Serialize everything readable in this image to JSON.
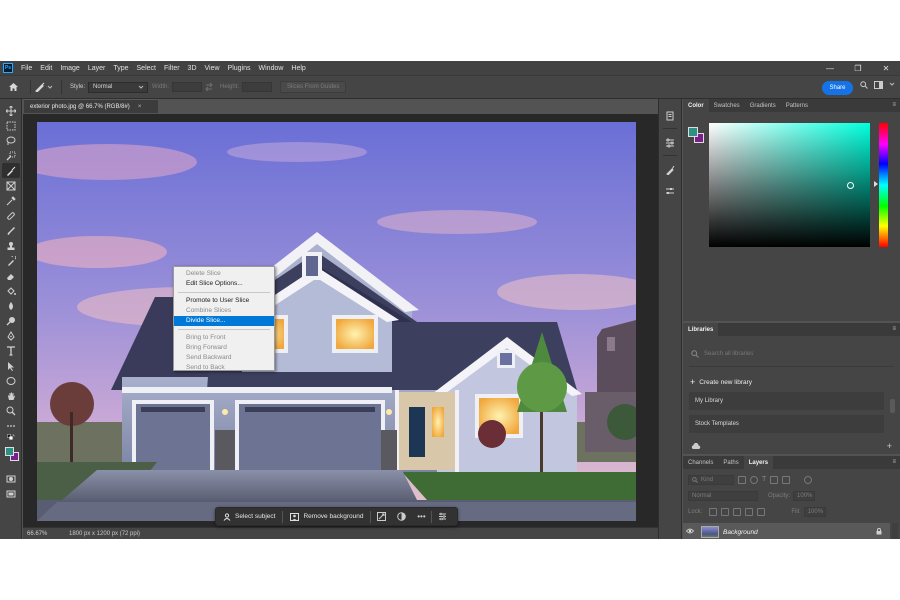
{
  "app": {
    "logo": "Ps",
    "brand_color": "#31a8ff",
    "accent": "#1473e6"
  },
  "menubar": {
    "items": [
      "File",
      "Edit",
      "Image",
      "Layer",
      "Type",
      "Select",
      "Filter",
      "3D",
      "View",
      "Plugins",
      "Window",
      "Help"
    ],
    "controls": {
      "minimize": "—",
      "restore": "❐",
      "close": "✕"
    }
  },
  "options": {
    "style_label": "Style:",
    "style_value": "Normal",
    "width_label": "Width:",
    "height_label": "Height:",
    "slices_button": "Slices From Guides",
    "share_label": "Share"
  },
  "document": {
    "tab_title": "exterior photo.jpg @ 66.7% (RGB/8#)",
    "tab_close": "×",
    "zoom": "66.67%",
    "info": "1800 px x 1200 px (72 ppi)"
  },
  "context_menu": {
    "items": [
      {
        "label": "Delete Slice",
        "state": "disabled"
      },
      {
        "label": "Edit Slice Options...",
        "state": "enabled"
      },
      {
        "label": "Promote to User Slice",
        "state": "enabled"
      },
      {
        "label": "Combine Slices",
        "state": "disabled"
      },
      {
        "label": "Divide Slice...",
        "state": "highlighted"
      },
      {
        "label": "Bring to Front",
        "state": "disabled"
      },
      {
        "label": "Bring Forward",
        "state": "disabled"
      },
      {
        "label": "Send Backward",
        "state": "disabled"
      },
      {
        "label": "Send to Back",
        "state": "disabled"
      }
    ]
  },
  "taskbar": {
    "select_subject": "Select subject",
    "remove_background": "Remove background",
    "more": "•••"
  },
  "color_panel": {
    "tabs": [
      "Color",
      "Swatches",
      "Gradients",
      "Patterns"
    ],
    "active_tab": "Color",
    "foreground": "#2e9085",
    "background": "#7b1f8e",
    "hue_color": "#00ffdd"
  },
  "libraries_panel": {
    "tab": "Libraries",
    "search_placeholder": "Search all libraries",
    "create_label": "Create new library",
    "libraries": [
      "My Library",
      "Stock Templates"
    ]
  },
  "layers_panel": {
    "tabs": [
      "Channels",
      "Paths",
      "Layers"
    ],
    "active_tab": "Layers",
    "filter_label": "Kind",
    "blend_mode": "Normal",
    "opacity_label": "Opacity:",
    "opacity_value": "100%",
    "lock_label": "Lock:",
    "fill_label": "Fill:",
    "fill_value": "100%",
    "layers": [
      {
        "name": "Background",
        "visible": true,
        "locked": true
      }
    ],
    "footer_icons": [
      "link-icon",
      "fx-icon",
      "mask-icon",
      "adjustment-icon",
      "group-icon",
      "new-layer-icon",
      "trash-icon"
    ]
  },
  "icons": {
    "eye": "👁",
    "lock": "🔒",
    "plus": "+"
  }
}
